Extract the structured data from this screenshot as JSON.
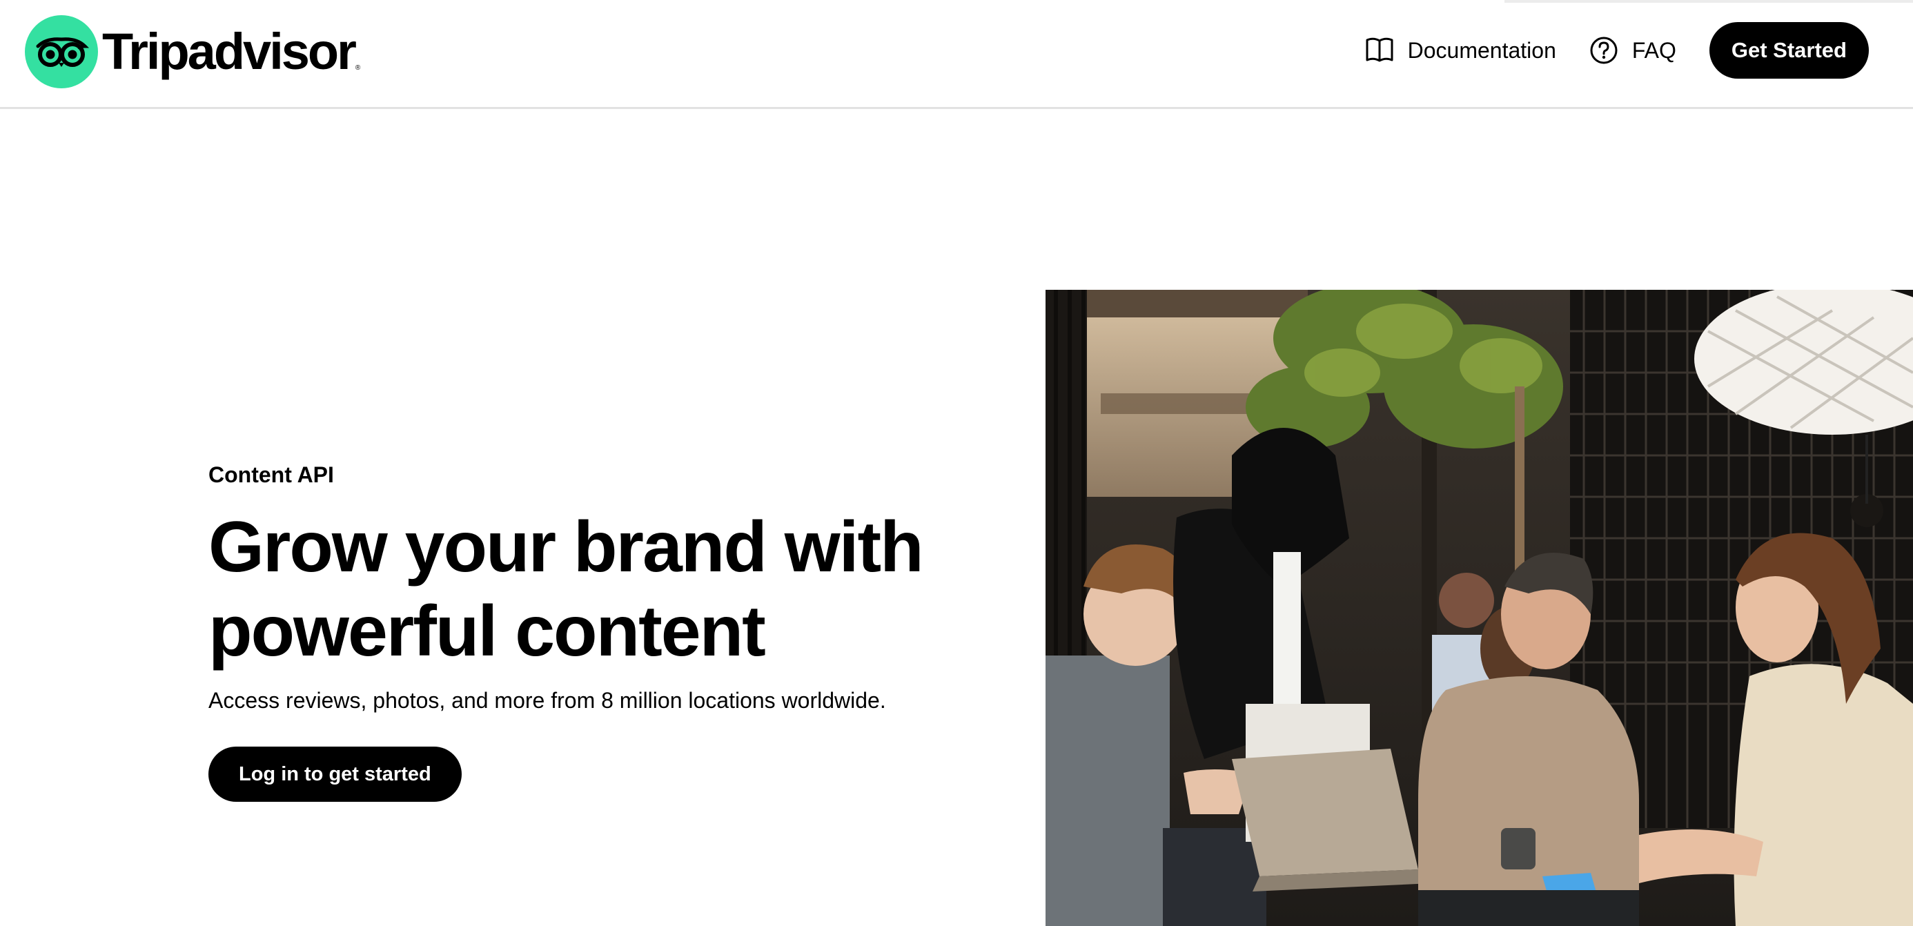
{
  "brand": {
    "name": "Tripadvisor",
    "registered_mark": "®",
    "logo_color": "#34e0a1",
    "logo_icon": "owl-eyes-icon"
  },
  "nav": {
    "documentation": {
      "label": "Documentation",
      "icon": "book-icon"
    },
    "faq": {
      "label": "FAQ",
      "icon": "question-circle-icon"
    },
    "get_started": "Get Started"
  },
  "hero": {
    "eyebrow": "Content API",
    "headline_line1": "Grow your brand with",
    "headline_line2": "powerful content",
    "subtext": "Access reviews, photos, and more from 8 million locations worldwide.",
    "cta": "Log in to get started",
    "image_description": "Four colleagues gathered around a laptop in a casual office lounge with plants and a woven pendant lamp"
  },
  "colors": {
    "text": "#000000",
    "button_bg": "#000000",
    "button_text": "#ffffff",
    "divider": "#e2e2e2"
  }
}
